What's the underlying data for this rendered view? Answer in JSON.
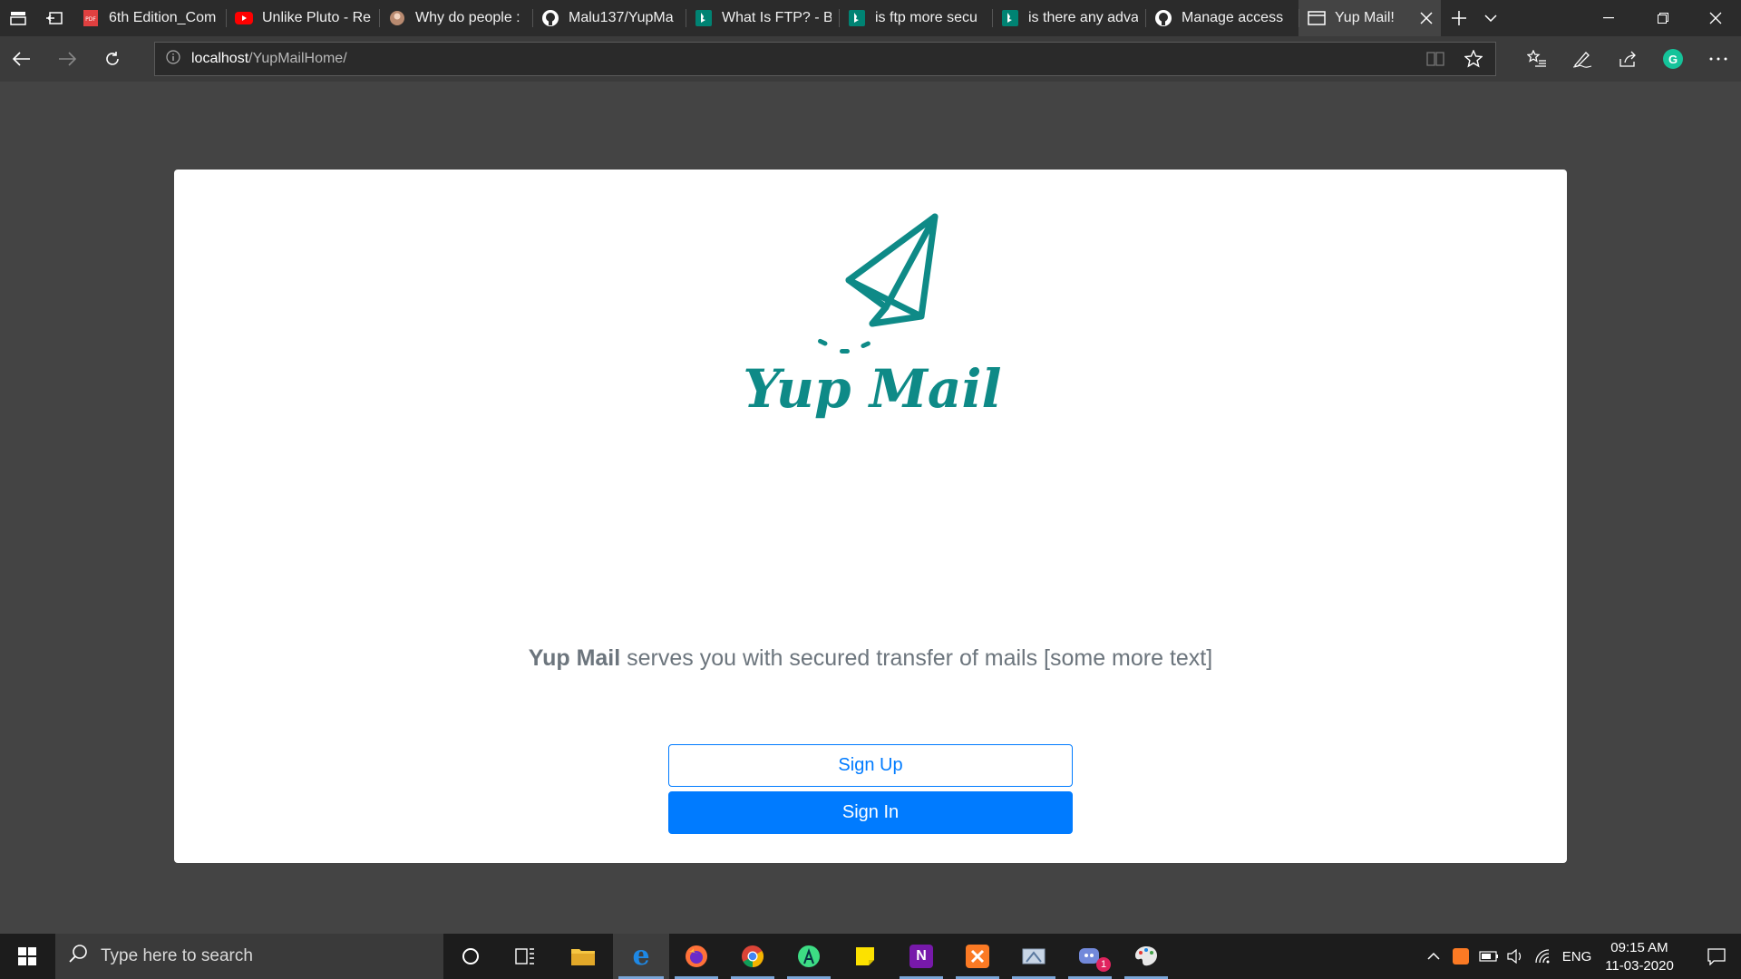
{
  "browser": {
    "tabs": [
      {
        "title": "6th Edition_Com",
        "icon": "pdf-icon"
      },
      {
        "title": "Unlike Pluto - Re",
        "icon": "youtube-icon"
      },
      {
        "title": "Why do people :",
        "icon": "avatar-icon"
      },
      {
        "title": "Malu137/YupMa",
        "icon": "github-icon"
      },
      {
        "title": "What Is FTP? - B",
        "icon": "bing-icon"
      },
      {
        "title": "is ftp more secu",
        "icon": "bing-icon"
      },
      {
        "title": "is there any adva",
        "icon": "bing-icon"
      },
      {
        "title": "Manage access",
        "icon": "github-icon"
      }
    ],
    "active_tab": {
      "title": "Yup Mail!",
      "icon": "page-icon"
    },
    "address": {
      "host": "localhost",
      "path": "/YupMailHome/"
    }
  },
  "page": {
    "logo_text": "Yup Mail",
    "tagline_brand": "Yup Mail",
    "tagline_rest": " serves you with secured transfer of mails [some more text]",
    "sign_up_label": "Sign Up",
    "sign_in_label": "Sign In",
    "colors": {
      "brand_teal": "#0e8a87",
      "primary": "#007bff",
      "muted_text": "#6c757d",
      "page_bg": "#444444"
    }
  },
  "taskbar": {
    "search_placeholder": "Type here to search",
    "apps": [
      "cortana-icon",
      "task-view-icon",
      "file-explorer-icon",
      "edge-icon",
      "firefox-icon",
      "chrome-icon",
      "android-studio-icon",
      "sticky-notes-icon",
      "onenote-icon",
      "xampp-icon",
      "snipping-icon",
      "discord-icon",
      "paint-icon"
    ],
    "discord_badge": "1",
    "language": "ENG",
    "time": "09:15 AM",
    "date": "11-03-2020"
  }
}
